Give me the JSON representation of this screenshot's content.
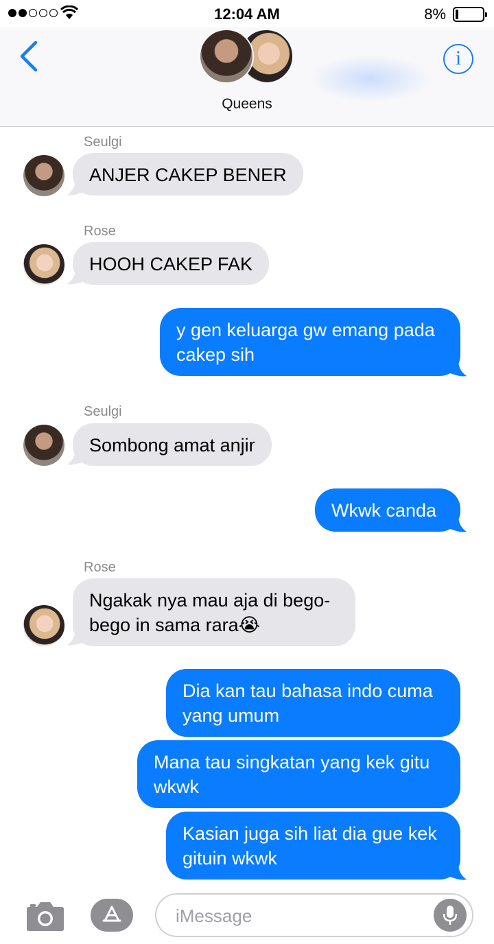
{
  "status_bar": {
    "time": "12:04 AM",
    "battery_percent": "8%",
    "signal_bars_filled": 2,
    "signal_bars_total": 5
  },
  "header": {
    "group_name": "Queens",
    "back_icon": "chevron-left-icon",
    "info_label": "i"
  },
  "messages": [
    {
      "sender": "Seulgi",
      "direction": "incoming",
      "text": "ANJER CAKEP BENER"
    },
    {
      "sender": "Rose",
      "direction": "incoming",
      "text": "HOOH CAKEP FAK"
    },
    {
      "direction": "outgoing",
      "text": "y gen keluarga gw emang pada cakep sih"
    },
    {
      "sender": "Seulgi",
      "direction": "incoming",
      "text": "Sombong amat anjir"
    },
    {
      "direction": "outgoing",
      "text": "Wkwk canda"
    },
    {
      "sender": "Rose",
      "direction": "incoming",
      "text": "Ngakak nya mau aja di bego-bego in sama rara😭"
    },
    {
      "direction": "outgoing",
      "text": "Dia kan tau bahasa indo cuma yang umum"
    },
    {
      "direction": "outgoing",
      "text": "Mana tau singkatan yang kek gitu wkwk"
    },
    {
      "direction": "outgoing",
      "text": "Kasian juga sih liat dia gue kek gituin wkwk"
    }
  ],
  "composer": {
    "placeholder": "iMessage"
  },
  "colors": {
    "accent": "#1a7cf5",
    "outgoing_bubble": "#0a7cff",
    "incoming_bubble": "#e5e5ea"
  }
}
